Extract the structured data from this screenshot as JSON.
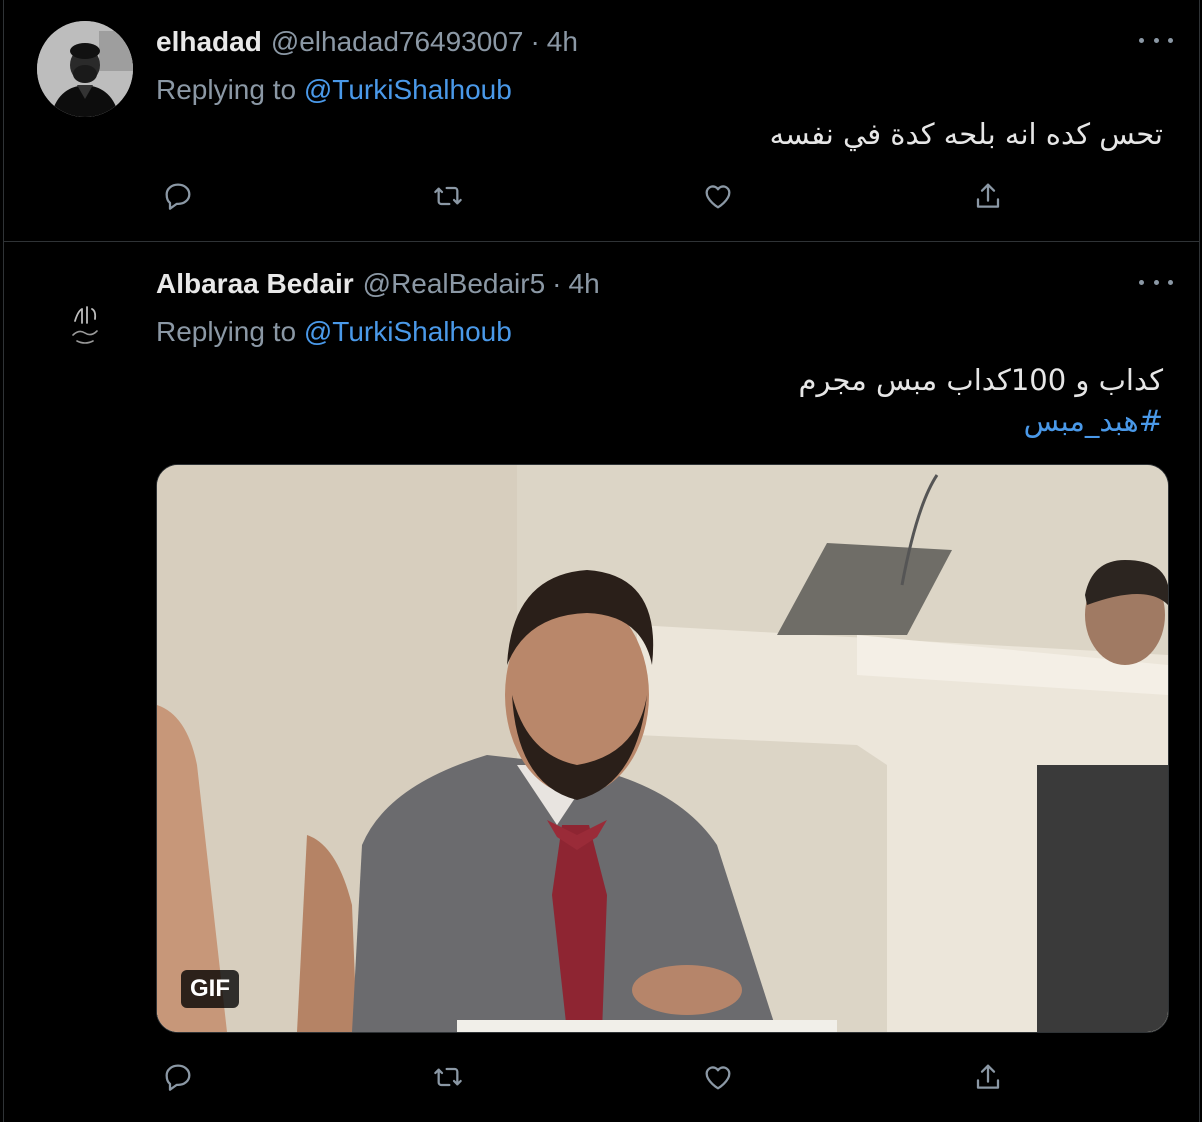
{
  "tweets": [
    {
      "name": "elhadad",
      "handle": "@elhadad76493007",
      "separator": "·",
      "time": "4h",
      "replying_prefix": "Replying to",
      "replying_to": "@TurkiShalhoub",
      "text": "تحس كده انه بلحه كدة في نفسه",
      "avatar_icon": "profile-photo"
    },
    {
      "name": "Albaraa Bedair",
      "handle": "@RealBedair5",
      "separator": "·",
      "time": "4h",
      "replying_prefix": "Replying to",
      "replying_to": "@TurkiShalhoub",
      "text": "كداب و 100كداب مبس مجرم",
      "hashtag": "#هبد_مبس",
      "media_badge": "GIF",
      "avatar_icon": "calligraphy-logo"
    }
  ],
  "action_icons": [
    "reply-icon",
    "retweet-icon",
    "like-icon",
    "share-icon"
  ],
  "colors": {
    "background": "#000000",
    "link": "#4a99e9",
    "muted": "#8b98a5",
    "divider": "#2f3336"
  }
}
